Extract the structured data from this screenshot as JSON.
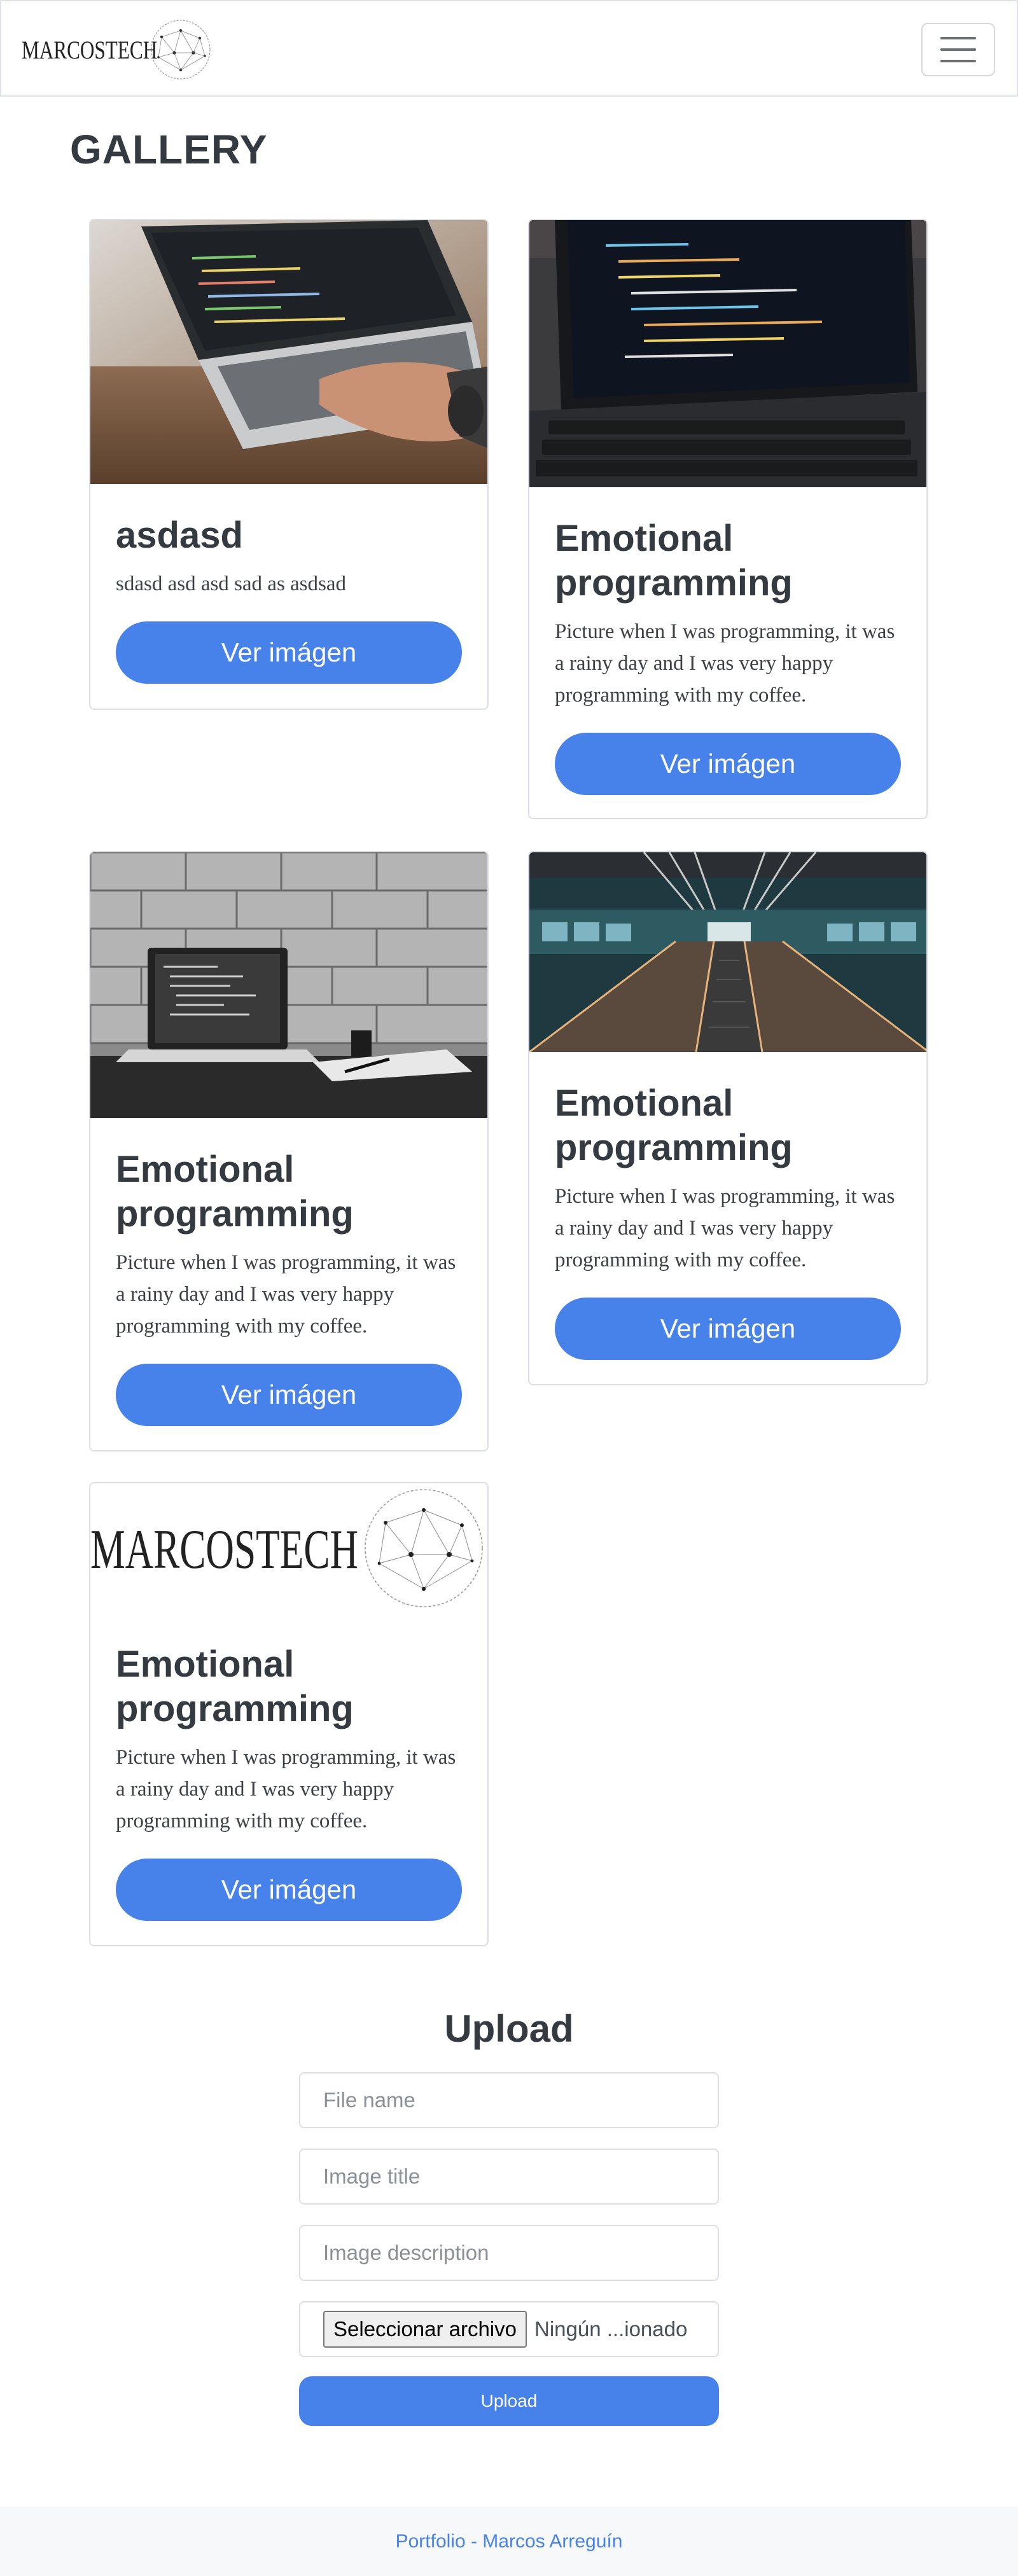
{
  "navbar": {
    "brand_text": "MARCOSTECH",
    "brand_icon": "network-globe-icon",
    "menu_icon": "hamburger-menu-icon"
  },
  "gallery": {
    "title": "GALLERY",
    "cards": [
      {
        "title": "asdasd",
        "text": "sdasd asd asd sad as asdsad",
        "button": "Ver imágen",
        "image": "laptop-code-photo"
      },
      {
        "title": "Emotional programming",
        "text": "Picture when I was programming, it was a rainy day and I was very happy programming with my coffee.",
        "button": "Ver imágen",
        "image": "laptop-keyboard-photo"
      },
      {
        "title": "Emotional programming",
        "text": "Picture when I was programming, it was a rainy day and I was very happy programming with my coffee.",
        "button": "Ver imágen",
        "image": "laptop-brick-wall-photo"
      },
      {
        "title": "Emotional programming",
        "text": "Picture when I was programming, it was a rainy day and I was very happy programming with my coffee.",
        "button": "Ver imágen",
        "image": "escalator-photo"
      },
      {
        "title": "Emotional programming",
        "text": "Picture when I was programming, it was a rainy day and I was very happy programming with my coffee.",
        "button": "Ver imágen",
        "image": "marcostech-logo",
        "image_text": "MARCOSTECH"
      }
    ]
  },
  "upload": {
    "title": "Upload",
    "file_name_placeholder": "File name",
    "image_title_placeholder": "Image title",
    "image_description_placeholder": "Image description",
    "file_button": "Seleccionar archivo",
    "file_status": "Ningún ...ionado",
    "submit": "Upload"
  },
  "footer": {
    "link_text": "Portfolio - Marcos Arreguín"
  },
  "colors": {
    "accent": "#4782ea",
    "text": "#343a40",
    "border": "#dcdfe3",
    "footer_bg": "#f7f8f9"
  }
}
